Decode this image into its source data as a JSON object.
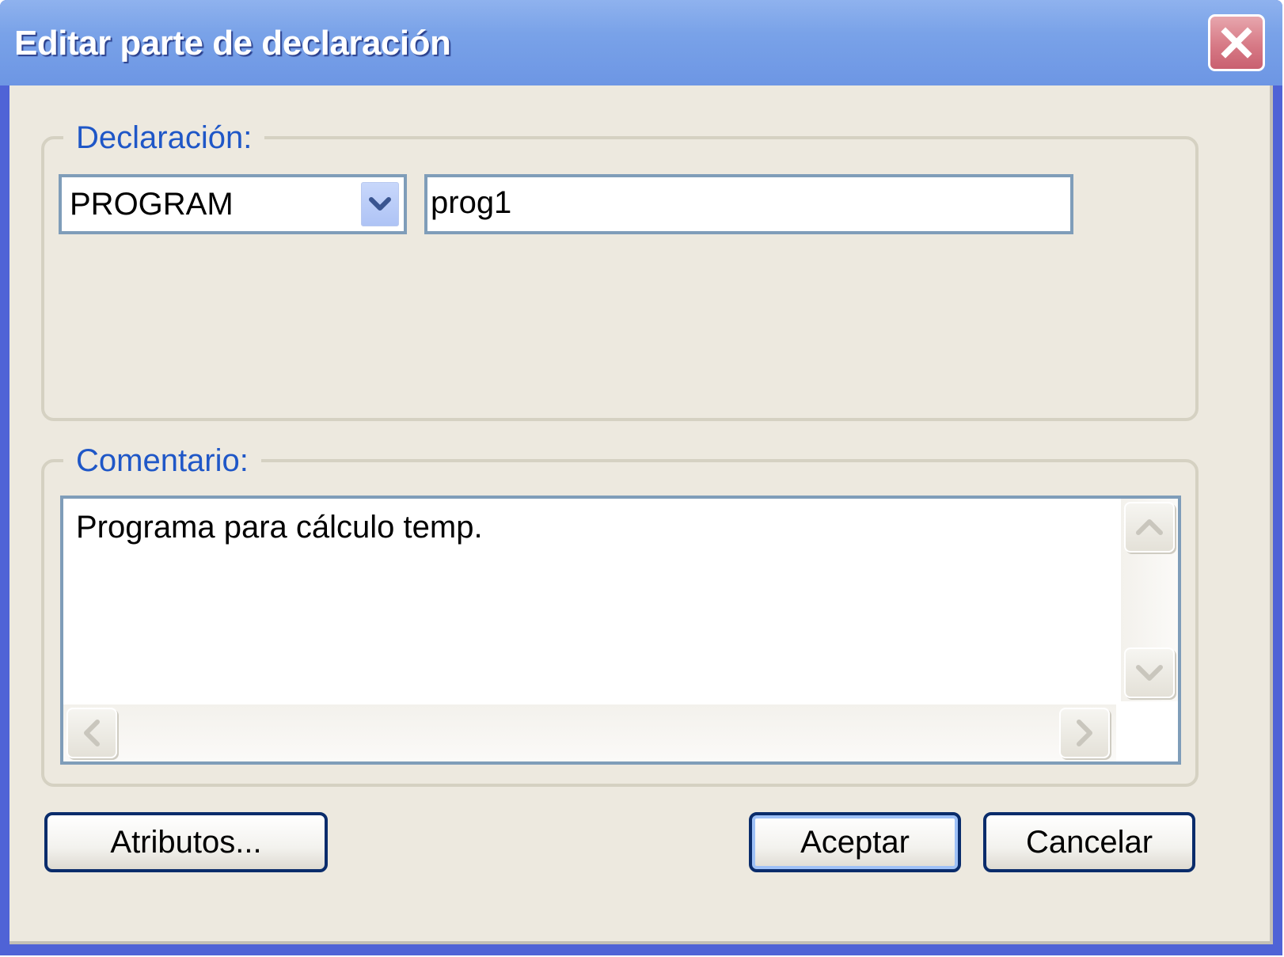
{
  "window": {
    "title": "Editar parte de declaración",
    "close_icon": "close-icon"
  },
  "declaration": {
    "legend": "Declaración:",
    "type_select": {
      "value": "PROGRAM",
      "icon": "chevron-down-icon"
    },
    "name_input": {
      "value": "prog1"
    }
  },
  "comment": {
    "legend": "Comentario:",
    "text": "Programa para cálculo temp."
  },
  "buttons": {
    "attributes": "Atributos...",
    "ok": "Aceptar",
    "cancel": "Cancelar"
  },
  "colors": {
    "titlebar": "#79a2e8",
    "close": "#d77a86",
    "dialog_bg": "#ede9df",
    "legend_text": "#1f57c7",
    "field_border": "#7f9db9",
    "button_border": "#0a2c6b"
  }
}
